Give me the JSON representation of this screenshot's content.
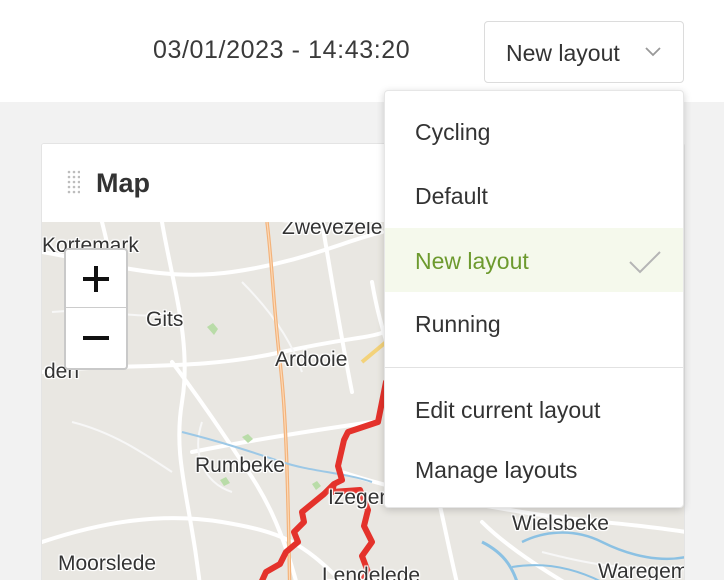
{
  "header": {
    "datetime": "03/01/2023 - 14:43:20",
    "layout_select": {
      "value": "New layout",
      "icon": "chevron-down-icon"
    }
  },
  "dropdown": {
    "items": [
      {
        "label": "Cycling",
        "selected": false
      },
      {
        "label": "Default",
        "selected": false
      },
      {
        "label": "New layout",
        "selected": true
      },
      {
        "label": "Running",
        "selected": false
      }
    ],
    "actions": [
      {
        "label": "Edit current layout"
      },
      {
        "label": "Manage layouts"
      }
    ]
  },
  "card": {
    "title": "Map",
    "drag_icon": "drag-handle-icon"
  },
  "map": {
    "zoom_in": "+",
    "zoom_out": "−",
    "towns": [
      "Zwevezele",
      "Kortemark",
      "Gits",
      "Ardooie",
      "den",
      "Rumbeke",
      "Izegem",
      "Wielsbeke",
      "Moorslede",
      "Lendelede",
      "Waregem"
    ],
    "route_color": "#e4322b"
  },
  "colors": {
    "accent_green": "#6d9a2e",
    "selected_bg": "#f5f9ec",
    "map_bg": "#e9e7e2"
  }
}
